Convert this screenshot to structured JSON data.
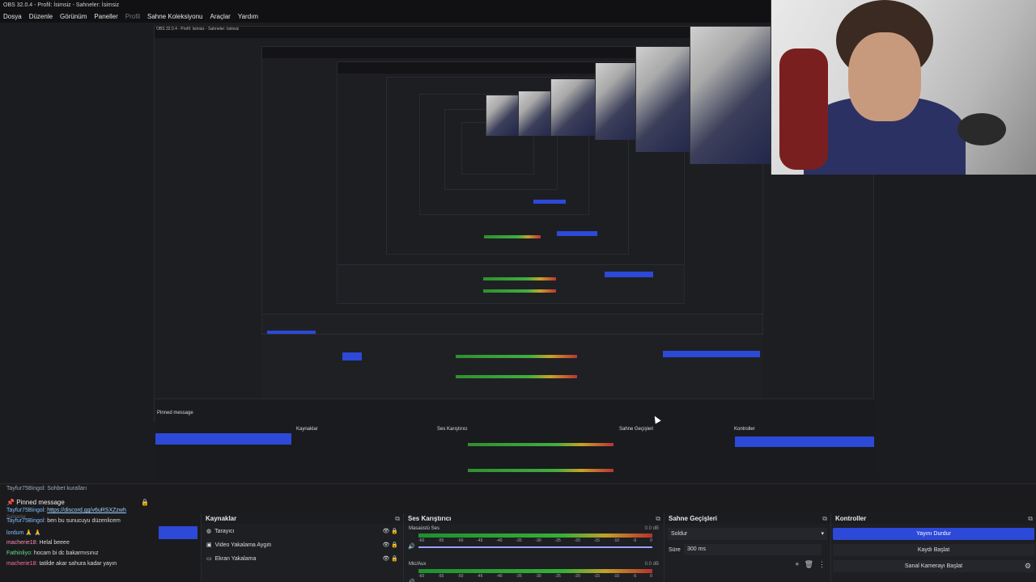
{
  "window": {
    "title": "OBS 32.0.4 - Profil: İsimsiz - Sahneler: İsimsiz"
  },
  "menu": [
    {
      "label": "Dosya",
      "dim": false
    },
    {
      "label": "Düzenle",
      "dim": false
    },
    {
      "label": "Görünüm",
      "dim": false
    },
    {
      "label": "Paneller",
      "dim": false
    },
    {
      "label": "Profil",
      "dim": true
    },
    {
      "label": "Sahne Koleksiyonu",
      "dim": false
    },
    {
      "label": "Araçlar",
      "dim": false
    },
    {
      "label": "Yardım",
      "dim": false
    }
  ],
  "chat": {
    "top_line": "Tayfur75Bingol: Sohbet kuralları",
    "pinned_label": "Pinned message",
    "scenes_label": "Sahneler",
    "messages": [
      {
        "user": "Tayfur75Bingol:",
        "text": "https://discord.gg/v6uRSXZzwh",
        "is_link": true,
        "cls": "u1"
      },
      {
        "user": "Tayfur75Bingol:",
        "text": "ben bu sunucuyu düzenlicem",
        "is_link": false,
        "cls": "u1"
      },
      {
        "user": "",
        "text": "lordum 🙏 🙏",
        "is_link": false,
        "cls": "u1"
      },
      {
        "user": "macherie18:",
        "text": "Helal beeee",
        "is_link": false,
        "cls": "u2"
      },
      {
        "user": "Fathinliyo:",
        "text": "hocam bi dc bakarmısınız",
        "is_link": false,
        "cls": "u3"
      },
      {
        "user": "macherie18:",
        "text": "tatilde akar sahura kadar yayın",
        "is_link": false,
        "cls": "u4"
      }
    ]
  },
  "sources": {
    "title": "Kaynaklar",
    "items": [
      {
        "label": "Tarayıcı",
        "icon": "globe-icon"
      },
      {
        "label": "Video Yakalama Aygıtı",
        "icon": "camera-icon"
      },
      {
        "label": "Ekran Yakalama",
        "icon": "monitor-icon"
      }
    ]
  },
  "mixer": {
    "title": "Ses Karıştırıcı",
    "channels": [
      {
        "name": "Masaüstü Ses",
        "db": "0.0 dB"
      },
      {
        "name": "Mic/Aux",
        "db": "0.0 dB"
      }
    ],
    "ticks": [
      "-60",
      "-55",
      "-50",
      "-45",
      "-40",
      "-35",
      "-30",
      "-25",
      "-20",
      "-15",
      "-10",
      "-5",
      "0"
    ]
  },
  "transitions": {
    "title": "Sahne Geçişleri",
    "selected": "Soldur",
    "duration_label": "Süre",
    "duration_value": "300 ms"
  },
  "controls": {
    "title": "Kontroller",
    "buttons": [
      "Yayını Durdur",
      "Kaydı Başlat",
      "Sanal Kamerayı Başlat"
    ]
  }
}
